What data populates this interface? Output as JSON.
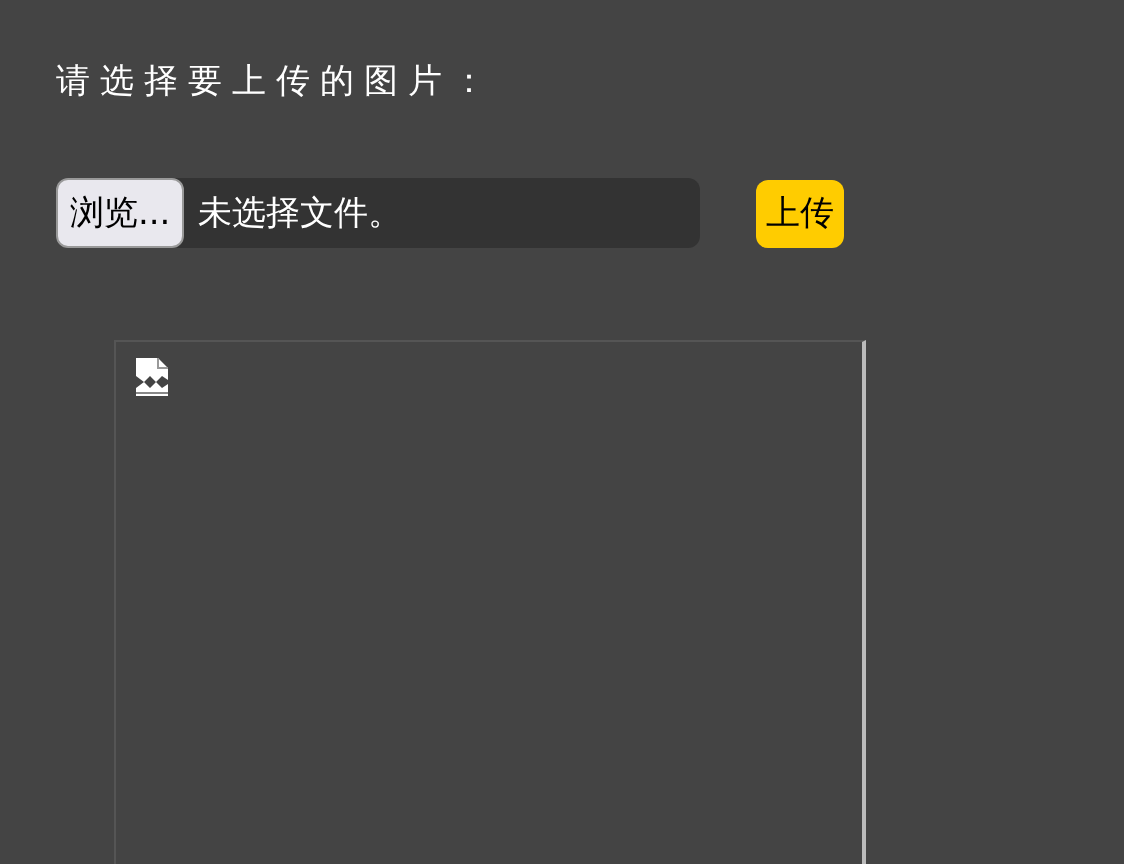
{
  "heading": "请选择要上传的图片：",
  "file_picker": {
    "button": "浏览...",
    "status": "未选择文件。"
  },
  "upload_button": "上传",
  "preview": {
    "kind": "broken-image"
  }
}
